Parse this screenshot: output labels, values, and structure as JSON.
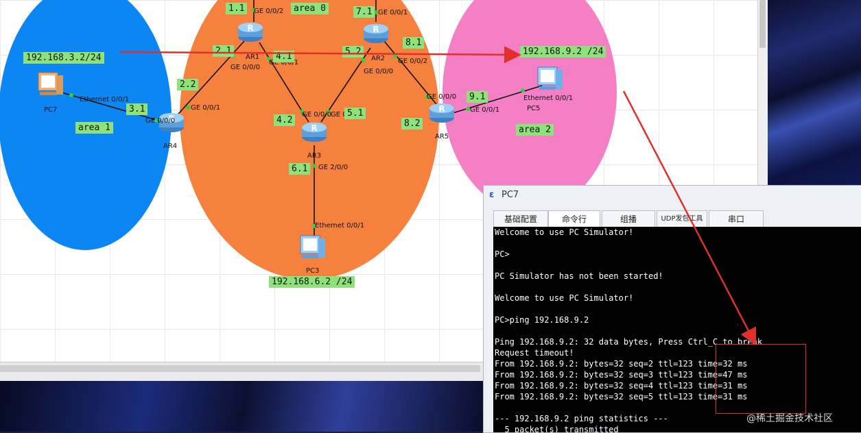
{
  "topology": {
    "areas": {
      "area0": "area 0",
      "area1": "area 1",
      "area2": "area 2"
    },
    "devices": {
      "ar1": "AR1",
      "ar2": "AR2",
      "ar3": "AR3",
      "ar4": "AR4",
      "ar5": "AR5",
      "pc7": "PC7",
      "pc5": "PC5",
      "pc3": "PC3"
    },
    "addr_labels": {
      "l11": "1.1",
      "l21": "2.1",
      "l41": "4.1",
      "l71": "7.1",
      "l52": "5.2",
      "l81": "8.1",
      "l22": "2.2",
      "l31": "3.1",
      "l42": "4.2",
      "l51": "5.1",
      "l61": "6.1",
      "l82": "8.2",
      "l91": "9.1",
      "pc7_ip": "192.168.3.2/24",
      "pc5_ip": "192.168.9.2 /24",
      "pc3_ip": "192.168.6.2 /24"
    },
    "ports": {
      "ar1_g002": "GE 0/0/2",
      "ar1_g000": "GE 0/0/0",
      "ar1_g001": "GE 0/0/1",
      "ar2_g001": "GE 0/0/1",
      "ar2_g002": "GE 0/0/2",
      "ar2_g000": "GE 0/0/0",
      "ar4_g001": "GE 0/0/1",
      "ar4_g000": "GE 0/0/0",
      "ar3_g000": "GE 0/0/0",
      "ar3_g001": "GE 0/0/1",
      "ar3_g200": "GE 2/0/0",
      "ar5_g000": "GE 0/0/0",
      "ar5_g001": "GE 0/0/1",
      "pc7_eth": "Ethernet 0/0/1",
      "pc5_eth": "Ethernet 0/0/1",
      "pc3_eth": "Ethernet 0/0/1"
    },
    "colors": {
      "area0": "#f6803e",
      "area1": "#0b86f2",
      "area2": "#f47fc4",
      "label": "#8ee27a",
      "arrow": "#e0302c"
    }
  },
  "window": {
    "title": "PC7",
    "tabs": [
      "基础配置",
      "命令行",
      "组播",
      "UDP发包工具",
      "串口"
    ],
    "active_tab": "命令行"
  },
  "terminal": {
    "lines": [
      "Welcome to use PC Simulator!",
      "",
      "PC>",
      "",
      "PC Simulator has not been started!",
      "",
      "Welcome to use PC Simulator!",
      "",
      "PC>ping 192.168.9.2",
      "",
      "Ping 192.168.9.2: 32 data bytes, Press Ctrl_C to break",
      "Request timeout!",
      "From 192.168.9.2: bytes=32 seq=2 ttl=123 time=32 ms",
      "From 192.168.9.2: bytes=32 seq=3 ttl=123 time=47 ms",
      "From 192.168.9.2: bytes=32 seq=4 ttl=123 time=31 ms",
      "From 192.168.9.2: bytes=32 seq=5 ttl=123 time=31 ms",
      "",
      "--- 192.168.9.2 ping statistics ---",
      "  5 packet(s) transmitted"
    ]
  },
  "watermark": "@稀土掘金技术社区"
}
